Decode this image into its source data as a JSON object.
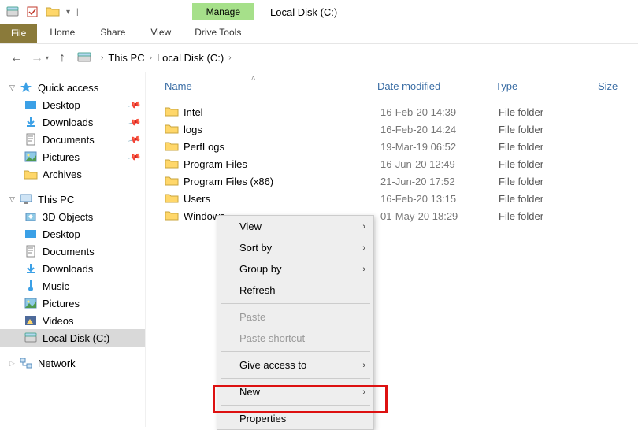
{
  "titlebar": {
    "manage": "Manage",
    "title": "Local Disk (C:)"
  },
  "ribbon": {
    "file": "File",
    "home": "Home",
    "share": "Share",
    "view": "View",
    "drive_tools": "Drive Tools"
  },
  "breadcrumb": {
    "this_pc": "This PC",
    "local_disk": "Local Disk (C:)"
  },
  "columns": {
    "name": "Name",
    "date": "Date modified",
    "type": "Type",
    "size": "Size"
  },
  "sidebar": {
    "quick_access": "Quick access",
    "qa_items": [
      {
        "label": "Desktop",
        "pin": true
      },
      {
        "label": "Downloads",
        "pin": true
      },
      {
        "label": "Documents",
        "pin": true
      },
      {
        "label": "Pictures",
        "pin": true
      },
      {
        "label": "Archives",
        "pin": false
      }
    ],
    "this_pc": "This PC",
    "pc_items": [
      {
        "label": "3D Objects"
      },
      {
        "label": "Desktop"
      },
      {
        "label": "Documents"
      },
      {
        "label": "Downloads"
      },
      {
        "label": "Music"
      },
      {
        "label": "Pictures"
      },
      {
        "label": "Videos"
      },
      {
        "label": "Local Disk (C:)"
      }
    ],
    "network": "Network"
  },
  "files": [
    {
      "name": "Intel",
      "date": "16-Feb-20 14:39",
      "type": "File folder"
    },
    {
      "name": "logs",
      "date": "16-Feb-20 14:24",
      "type": "File folder"
    },
    {
      "name": "PerfLogs",
      "date": "19-Mar-19 06:52",
      "type": "File folder"
    },
    {
      "name": "Program Files",
      "date": "16-Jun-20 12:49",
      "type": "File folder"
    },
    {
      "name": "Program Files (x86)",
      "date": "21-Jun-20 17:52",
      "type": "File folder"
    },
    {
      "name": "Users",
      "date": "16-Feb-20 13:15",
      "type": "File folder"
    },
    {
      "name": "Windows",
      "date": "01-May-20 18:29",
      "type": "File folder"
    }
  ],
  "context_menu": {
    "view": "View",
    "sort": "Sort by",
    "group": "Group by",
    "refresh": "Refresh",
    "paste": "Paste",
    "paste_shortcut": "Paste shortcut",
    "give_access": "Give access to",
    "new": "New",
    "properties": "Properties"
  }
}
